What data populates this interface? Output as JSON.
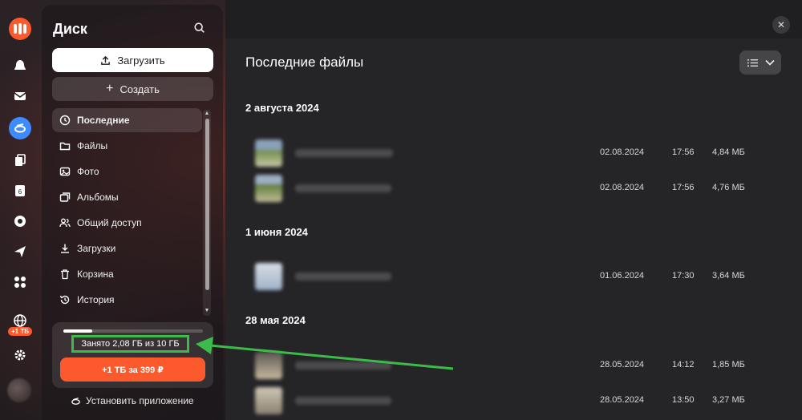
{
  "colors": {
    "accent_orange": "#fc5a2d",
    "active_blue": "#3d8bff",
    "annotation_green": "#3dbb4a"
  },
  "rail": {
    "icons": [
      "yandex-logo-icon",
      "cloud-icon",
      "mail-icon",
      "disk-icon",
      "docs-icon",
      "calendar-icon",
      "messenger-icon",
      "telemost-icon",
      "apps-icon"
    ],
    "calendar_day": "6",
    "badge": "+1 ТБ"
  },
  "sidebar": {
    "title": "Диск",
    "upload_label": "Загрузить",
    "create_label": "Создать",
    "items": [
      {
        "label": "Последние",
        "icon": "clock-icon"
      },
      {
        "label": "Файлы",
        "icon": "folder-icon"
      },
      {
        "label": "Фото",
        "icon": "photo-icon"
      },
      {
        "label": "Альбомы",
        "icon": "albums-icon"
      },
      {
        "label": "Общий доступ",
        "icon": "shared-icon"
      },
      {
        "label": "Загрузки",
        "icon": "download-icon"
      },
      {
        "label": "Корзина",
        "icon": "trash-icon"
      },
      {
        "label": "История",
        "icon": "history-icon"
      }
    ],
    "storage_text": "Занято 2,08 ГБ из 10 ГБ",
    "storage_fraction": 0.208,
    "offer_label": "+1 ТБ за 399 ₽",
    "install_label": "Установить приложение"
  },
  "main": {
    "title": "Последние файлы",
    "groups": [
      {
        "title": "2 августа 2024",
        "files": [
          {
            "date": "02.08.2024",
            "time": "17:56",
            "size": "4,84 МБ"
          },
          {
            "date": "02.08.2024",
            "time": "17:56",
            "size": "4,76 МБ"
          }
        ]
      },
      {
        "title": "1 июня 2024",
        "files": [
          {
            "date": "01.06.2024",
            "time": "17:30",
            "size": "3,64 МБ"
          }
        ]
      },
      {
        "title": "28 мая 2024",
        "files": [
          {
            "date": "28.05.2024",
            "time": "14:12",
            "size": "1,85 МБ"
          },
          {
            "date": "28.05.2024",
            "time": "13:50",
            "size": "3,27 МБ"
          }
        ]
      }
    ]
  }
}
